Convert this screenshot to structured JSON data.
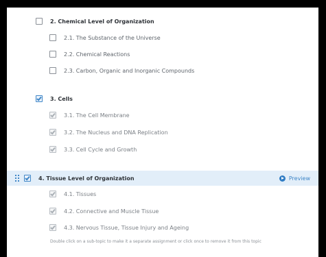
{
  "topics": [
    {
      "label": "2. Chemical Level of Organization",
      "checked": false,
      "subtopics": [
        {
          "label": "2.1. The Substance of the Universe",
          "checked": false
        },
        {
          "label": "2.2. Chemical Reactions",
          "checked": false
        },
        {
          "label": "2.3. Carbon, Organic and Inorganic Compounds",
          "checked": false
        }
      ]
    },
    {
      "label": "3. Cells",
      "checked": true,
      "subtopics": [
        {
          "label": "3.1. The Cell Membrane",
          "checked": true
        },
        {
          "label": "3.2. The Nucleus and DNA Replication",
          "checked": true
        },
        {
          "label": "3.3. Cell Cycle and Growth",
          "checked": true
        }
      ]
    },
    {
      "label": "4. Tissue Level of Organization",
      "checked": true,
      "subtopics": [
        {
          "label": "4.1. Tissues",
          "checked": true
        },
        {
          "label": "4.2. Connective and Muscle Tissue",
          "checked": true
        },
        {
          "label": "4.3. Nervous Tissue, Tissue Injury and Ageing",
          "checked": true
        }
      ]
    }
  ],
  "preview_label": "Preview",
  "hint_text": "Double click on a sub-topic to make it a separate assignment or click once to remove it from this topic",
  "colors": {
    "accent": "#3f86c7",
    "highlight": "#e2eef9"
  },
  "icons": {
    "checkbox": "checkbox-icon",
    "drag": "drag-handle-icon",
    "preview": "play-circle-icon"
  }
}
